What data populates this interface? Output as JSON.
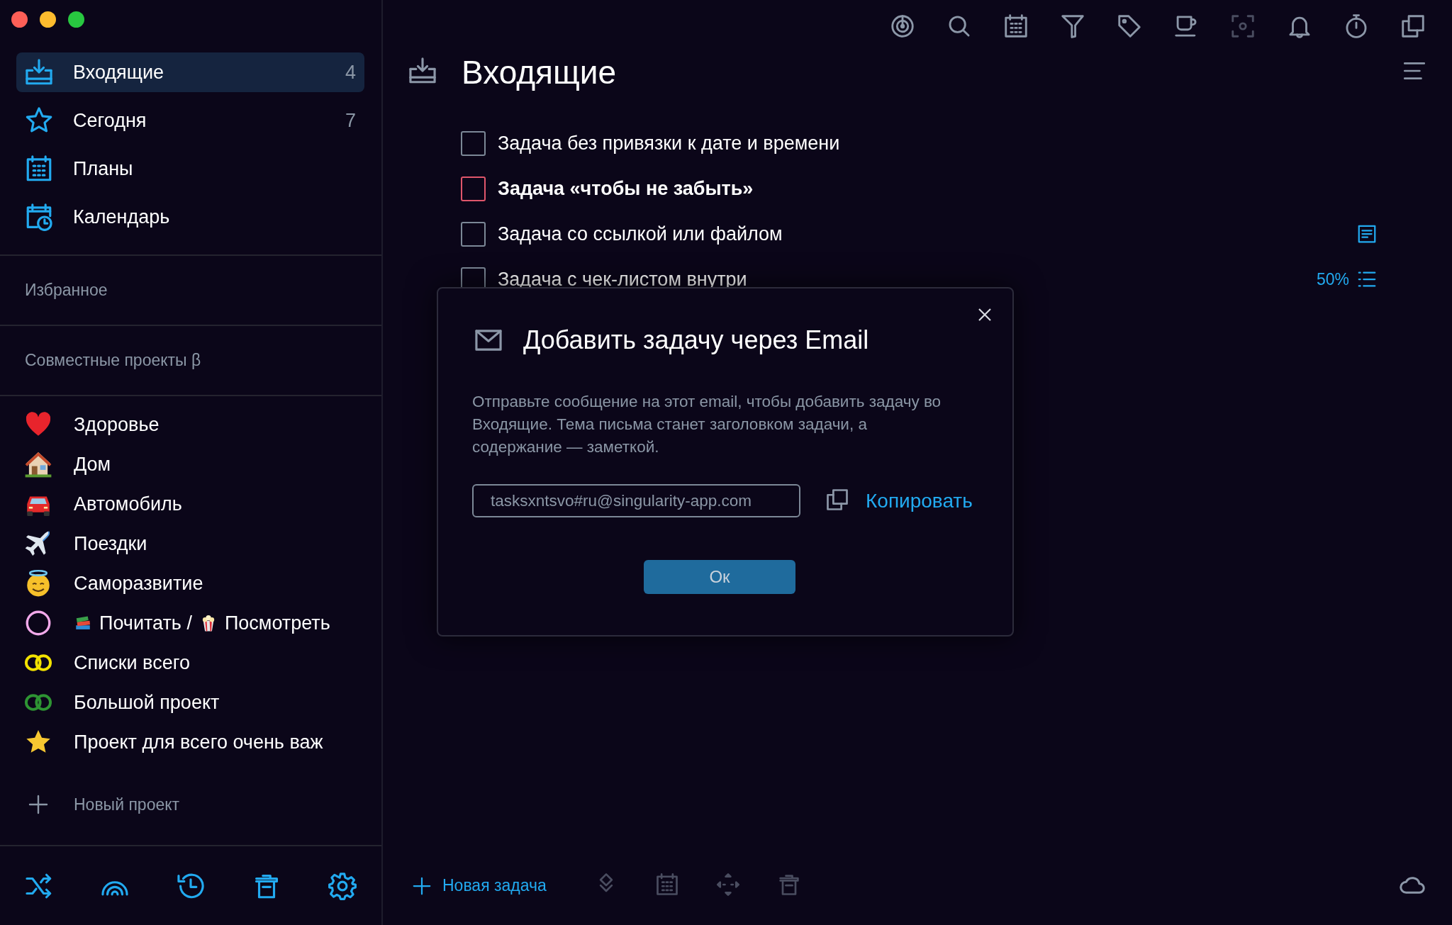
{
  "nav": [
    {
      "label": "Входящие",
      "count": "4",
      "selected": true
    },
    {
      "label": "Сегодня",
      "count": "7",
      "selected": false
    },
    {
      "label": "Планы",
      "selected": false
    },
    {
      "label": "Календарь",
      "selected": false
    }
  ],
  "sections": [
    "Избранное",
    "Совместные проекты β"
  ],
  "projects": [
    {
      "kind": "heart",
      "label": "Здоровье"
    },
    {
      "kind": "house",
      "label": "Дом"
    },
    {
      "kind": "car",
      "label": "Автомобиль"
    },
    {
      "kind": "plane",
      "label": "Поездки"
    },
    {
      "kind": "smiley",
      "label": "Саморазвитие"
    },
    {
      "kind": "circle",
      "color": "#f2a9ea",
      "parts": [
        {
          "kind": "books",
          "text": "Почитать /"
        },
        {
          "kind": "popcorn",
          "text": "Посмотреть"
        }
      ]
    },
    {
      "kind": "rings",
      "color": "#f2e200",
      "label": "Списки всего"
    },
    {
      "kind": "rings",
      "color": "#2e9433",
      "label": "Большой проект"
    },
    {
      "kind": "star",
      "label": "Проект для всего очень важ"
    }
  ],
  "new_project": "Новый проект",
  "toolbar": [
    {
      "disabled": false
    },
    {
      "disabled": false
    },
    {
      "disabled": false
    },
    {
      "disabled": false
    },
    {
      "disabled": false
    },
    {
      "disabled": false
    },
    {
      "disabled": true
    },
    {
      "disabled": false
    },
    {
      "disabled": false
    },
    {
      "disabled": false
    }
  ],
  "title": "Входящие",
  "tasks": [
    {
      "title": "Задача без привязки к дате и времени",
      "important": false,
      "checked": false,
      "kind": "plain"
    },
    {
      "title": "Задача «чтобы не забыть»",
      "important": true,
      "checked": false,
      "kind": "plain"
    },
    {
      "title": "Задача со ссылкой или файлом",
      "important": false,
      "checked": false,
      "kind": "note"
    },
    {
      "title": "Задача с чек-листом внутри",
      "important": false,
      "checked": false,
      "kind": "checklist",
      "progress": "50%"
    }
  ],
  "dialog": {
    "title": "Добавить задачу через Email",
    "text": "Отправьте сообщение на этот email, чтобы добавить задачу во Входящие. Тема письма станет заголовком задачи, а содержание — заметкой.",
    "email": "tasksxntsvo#ru@singularity-app.com",
    "copy": "Копировать",
    "ok": "Ок"
  },
  "bottom": {
    "new_task": "Новая задача",
    "actions": [
      {
        "disabled": true
      },
      {
        "disabled": true
      },
      {
        "disabled": true
      },
      {
        "disabled": true
      }
    ]
  }
}
